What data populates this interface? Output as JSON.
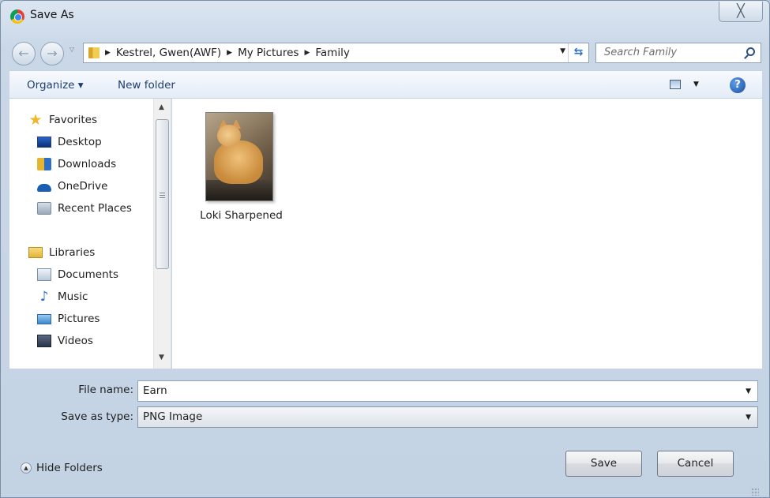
{
  "window": {
    "title": "Save As",
    "close_label": "╳"
  },
  "address": {
    "crumbs": [
      "Kestrel, Gwen(AWF)",
      "My Pictures",
      "Family"
    ],
    "separator": "▶",
    "dropdown": "▼",
    "refresh": "⇆"
  },
  "search": {
    "placeholder": "Search Family"
  },
  "toolbar": {
    "organize": "Organize ▾",
    "new_folder": "New folder",
    "view_dropdown": "▼",
    "help": "?"
  },
  "nav": {
    "favorites": "Favorites",
    "desktop": "Desktop",
    "downloads": "Downloads",
    "onedrive": "OneDrive",
    "recent": "Recent Places",
    "libraries": "Libraries",
    "documents": "Documents",
    "music": "Music",
    "pictures": "Pictures",
    "videos": "Videos",
    "scroll_up": "▲",
    "scroll_down": "▼"
  },
  "files": [
    {
      "name": "Loki Sharpened"
    }
  ],
  "form": {
    "file_name_label": "File name:",
    "file_name_value": "Earn",
    "type_label": "Save as type:",
    "type_value": "PNG Image",
    "dropdown": "▼"
  },
  "footer": {
    "hide_folders": "Hide Folders",
    "hide_icon": "▲",
    "save": "Save",
    "cancel": "Cancel"
  },
  "icons": {
    "back": "←",
    "forward": "→",
    "recent_arrow": "▽",
    "favorites_star": "★",
    "music_note": "♪"
  }
}
